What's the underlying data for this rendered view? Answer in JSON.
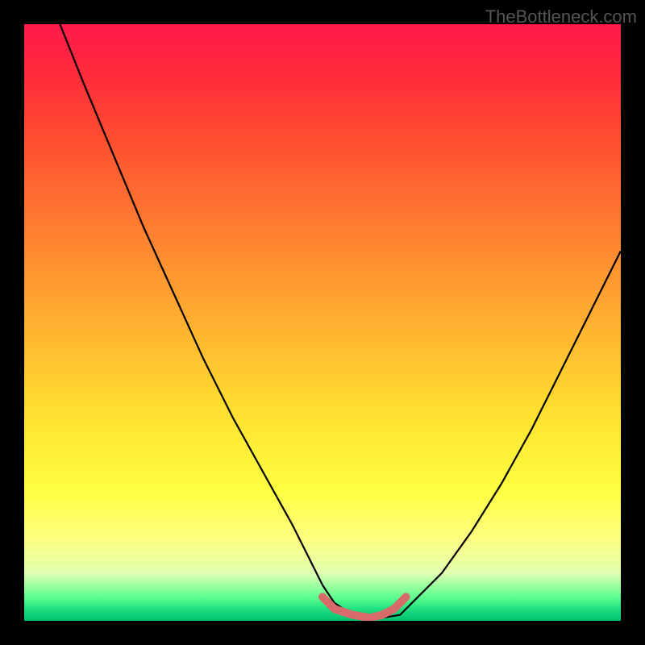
{
  "watermark": "TheBottleneck.com",
  "chart_data": {
    "type": "line",
    "title": "",
    "xlabel": "",
    "ylabel": "",
    "xlim": [
      0,
      100
    ],
    "ylim": [
      0,
      100
    ],
    "background_gradient": {
      "top": "#ff1a4a",
      "mid": "#ffe030",
      "bottom": "#00c070"
    },
    "series": [
      {
        "name": "main-curve",
        "color": "#000000",
        "x": [
          6,
          10,
          15,
          20,
          25,
          30,
          35,
          40,
          45,
          48,
          50,
          52,
          55,
          58,
          60,
          63,
          65,
          70,
          75,
          80,
          85,
          90,
          95,
          100
        ],
        "y": [
          100,
          90,
          78,
          66,
          55,
          44,
          34,
          25,
          16,
          10,
          6,
          3,
          1,
          0.5,
          0.5,
          1,
          3,
          8,
          15,
          23,
          32,
          42,
          52,
          62
        ]
      },
      {
        "name": "highlight-band",
        "color": "#e06060",
        "x": [
          50,
          52,
          55,
          58,
          60,
          62,
          64
        ],
        "y": [
          4,
          2,
          1,
          0.5,
          1,
          2,
          4
        ]
      }
    ],
    "annotations": []
  }
}
